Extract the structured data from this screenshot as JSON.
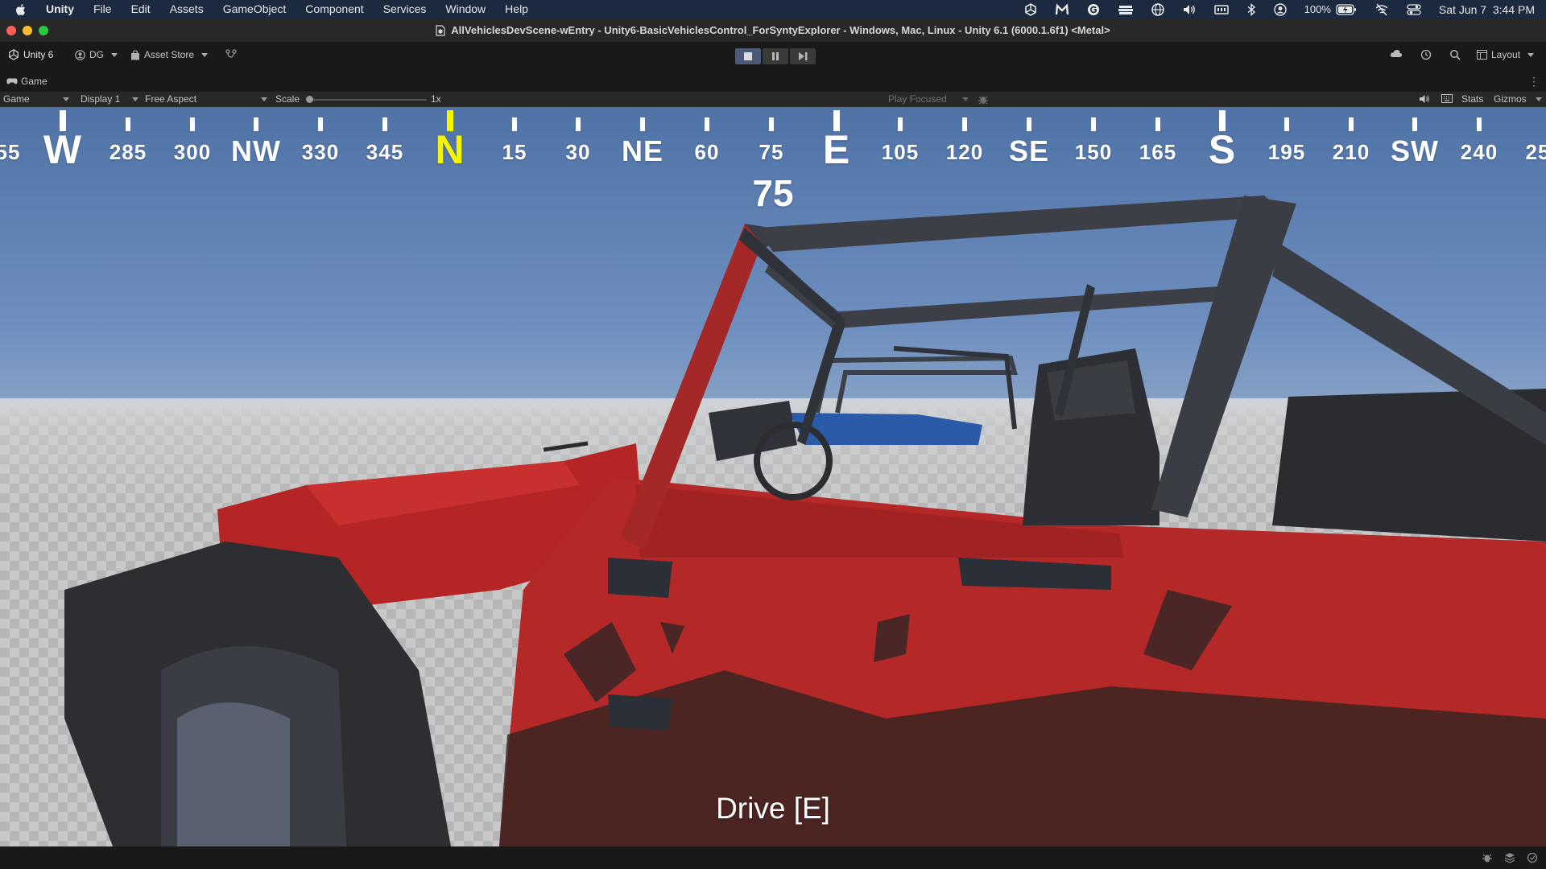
{
  "menubar": {
    "apple_icon": "apple-logo-icon",
    "items": [
      "Unity",
      "File",
      "Edit",
      "Assets",
      "GameObject",
      "Component",
      "Services",
      "Window",
      "Help"
    ],
    "battery": "100%",
    "datetime": "Sat Jun 7  3:44 PM"
  },
  "window": {
    "title": "AllVehiclesDevScene-wEntry - Unity6-BasicVehiclesControl_ForSyntyExplorer - Windows, Mac, Linux - Unity 6.1 (6000.1.6f1) <Metal>"
  },
  "toolbar": {
    "unity_label": "Unity 6",
    "account_label": "DG",
    "asset_store_label": "Asset Store",
    "layout_label": "Layout"
  },
  "tab": {
    "label": "Game"
  },
  "gamebar": {
    "mode": "Game",
    "display": "Display 1",
    "aspect": "Free Aspect",
    "scale_label": "Scale",
    "scale_value": "1x",
    "scale_fraction": 0,
    "play_focused": "Play Focused",
    "stats_label": "Stats",
    "gizmos_label": "Gizmos"
  },
  "hud": {
    "compass_labels": [
      "55",
      "W",
      "285",
      "300",
      "NW",
      "330",
      "345",
      "N",
      "15",
      "30",
      "NE",
      "60",
      "75",
      "E",
      "105",
      "120",
      "SE",
      "150",
      "165",
      "S",
      "195",
      "210",
      "SW",
      "240",
      "25"
    ],
    "heading": "75",
    "prompt": "Drive [E]",
    "north_color": "#f5f500",
    "text_color": "#ffffff"
  },
  "colors": {
    "menubar_bg": "#1c2a40",
    "editor_bg": "#191919",
    "vehicle_body": "#c22a2a",
    "vehicle_frame": "#383c42",
    "second_vehicle": "#2a5aa8"
  }
}
